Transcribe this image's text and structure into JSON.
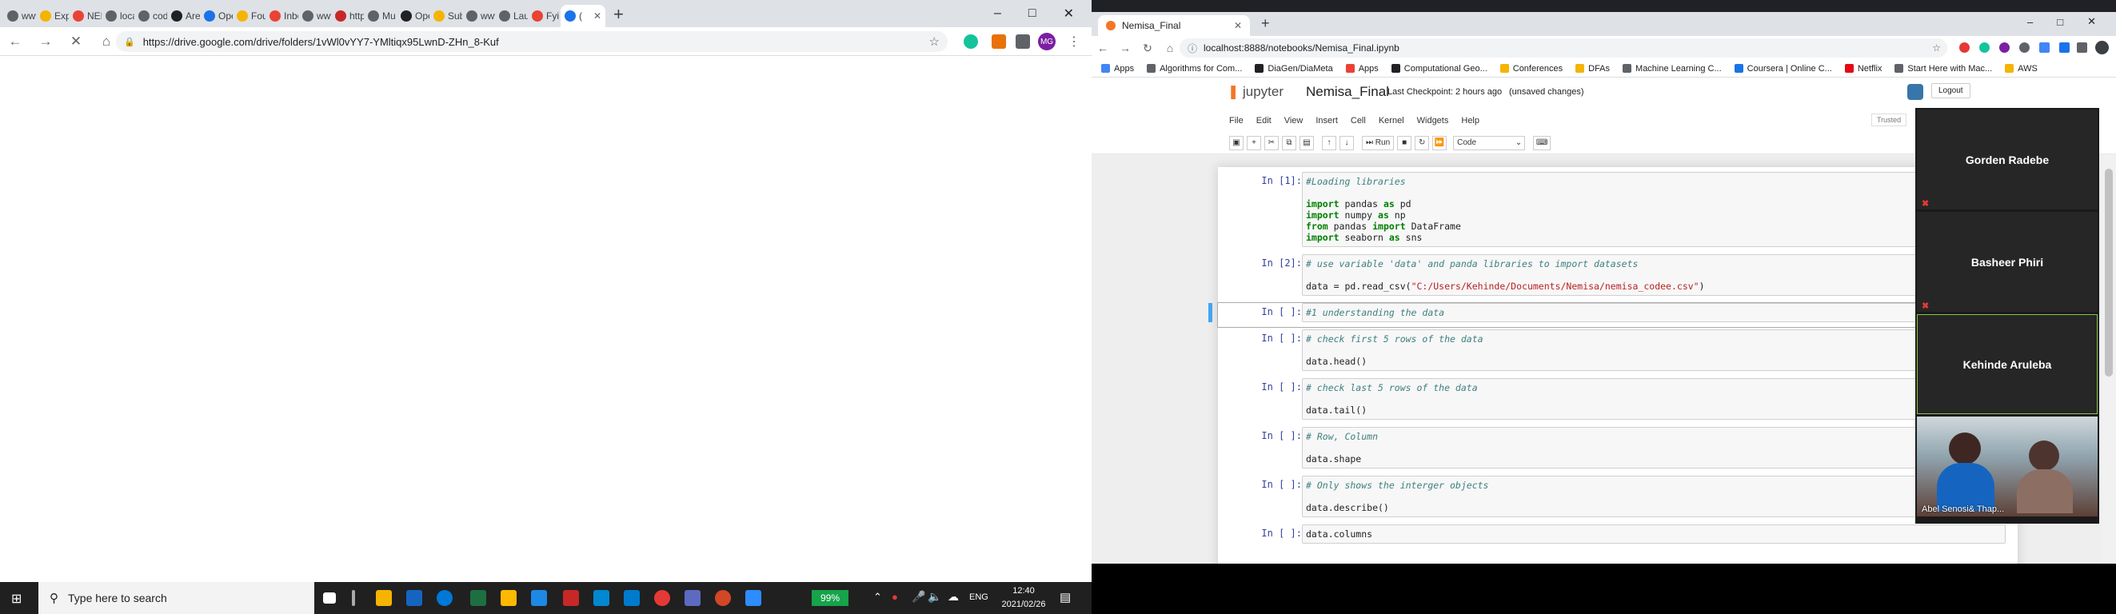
{
  "left_browser": {
    "tabs": [
      {
        "label": "www",
        "color": "#5f6368"
      },
      {
        "label": "Exp",
        "color": "#f4b400"
      },
      {
        "label": "NEN",
        "color": "#ea4335"
      },
      {
        "label": "loca",
        "color": "#5f6368"
      },
      {
        "label": "cod",
        "color": "#5f6368"
      },
      {
        "label": "Are",
        "color": "#202124"
      },
      {
        "label": "Ope",
        "color": "#1a73e8"
      },
      {
        "label": "Fou",
        "color": "#f4b400"
      },
      {
        "label": "Inbc",
        "color": "#ea4335"
      },
      {
        "label": "www",
        "color": "#5f6368"
      },
      {
        "label": "http",
        "color": "#c62828"
      },
      {
        "label": "Mu",
        "color": "#5f6368"
      },
      {
        "label": "Ope",
        "color": "#202124"
      },
      {
        "label": "Sub",
        "color": "#f4b400"
      },
      {
        "label": "www",
        "color": "#5f6368"
      },
      {
        "label": "Lau",
        "color": "#5f6368"
      },
      {
        "label": "Fyi",
        "color": "#ea4335"
      },
      {
        "label": "(",
        "color": "#1a73e8",
        "active": true
      }
    ],
    "url": "https://drive.google.com/drive/folders/1vWl0vYY7-YMltiqx95LwnD-ZHn_8-Kuf",
    "profile_initials": "MG"
  },
  "taskbar": {
    "search_placeholder": "Type here to search",
    "battery": "99%",
    "language": "ENG",
    "time": "12:40",
    "date": "2021/02/26"
  },
  "right_browser": {
    "tab_title": "Nemisa_Final",
    "url": "localhost:8888/notebooks/Nemisa_Final.ipynb",
    "bookmarks": [
      {
        "label": "Apps",
        "color": "#4285f4"
      },
      {
        "label": "Algorithms for Com...",
        "color": "#5f6368"
      },
      {
        "label": "DiaGen/DiaMeta",
        "color": "#202124"
      },
      {
        "label": "Apps",
        "color": "#ea4335"
      },
      {
        "label": "Computational Geo...",
        "color": "#202124"
      },
      {
        "label": "Conferences",
        "color": "#f4b400"
      },
      {
        "label": "DFAs",
        "color": "#f4b400"
      },
      {
        "label": "Machine Learning C...",
        "color": "#5f6368"
      },
      {
        "label": "Coursera | Online C...",
        "color": "#1a73e8"
      },
      {
        "label": "Netflix",
        "color": "#e50914"
      },
      {
        "label": "Start Here with Mac...",
        "color": "#5f6368"
      },
      {
        "label": "AWS",
        "color": "#f4b400"
      }
    ]
  },
  "jupyter": {
    "logo_text": "jupyter",
    "notebook_name": "Nemisa_Final",
    "checkpoint_label": "Last Checkpoint:",
    "checkpoint_time": "2 hours ago",
    "unsaved": "(unsaved changes)",
    "logout_label": "Logout",
    "trusted_label": "Trusted",
    "menu": [
      "File",
      "Edit",
      "View",
      "Insert",
      "Cell",
      "Kernel",
      "Widgets",
      "Help"
    ],
    "run_label": "Run",
    "cell_type": "Code",
    "cells": [
      {
        "prompt": "In [1]:",
        "lines": [
          {
            "parts": [
              {
                "t": "#Loading libraries",
                "c": "cm"
              }
            ]
          },
          {
            "parts": [
              {
                "t": "",
                "c": ""
              }
            ]
          },
          {
            "parts": [
              {
                "t": "import",
                "c": "kw"
              },
              {
                "t": " pandas ",
                "c": ""
              },
              {
                "t": "as",
                "c": "kw"
              },
              {
                "t": " pd",
                "c": ""
              }
            ]
          },
          {
            "parts": [
              {
                "t": "import",
                "c": "kw"
              },
              {
                "t": " numpy ",
                "c": ""
              },
              {
                "t": "as",
                "c": "kw"
              },
              {
                "t": " np",
                "c": ""
              }
            ]
          },
          {
            "parts": [
              {
                "t": "from",
                "c": "kw"
              },
              {
                "t": " pandas ",
                "c": ""
              },
              {
                "t": "import",
                "c": "kw"
              },
              {
                "t": " DataFrame",
                "c": ""
              }
            ]
          },
          {
            "parts": [
              {
                "t": "import",
                "c": "kw"
              },
              {
                "t": " seaborn ",
                "c": ""
              },
              {
                "t": "as",
                "c": "kw"
              },
              {
                "t": " sns",
                "c": ""
              }
            ]
          }
        ]
      },
      {
        "prompt": "In [2]:",
        "lines": [
          {
            "parts": [
              {
                "t": "# use variable 'data' and panda libraries to import datasets",
                "c": "cm"
              }
            ]
          },
          {
            "parts": [
              {
                "t": "",
                "c": ""
              }
            ]
          },
          {
            "parts": [
              {
                "t": "data = pd.read_csv(",
                "c": ""
              },
              {
                "t": "\"C:/Users/Kehinde/Documents/Nemisa/nemisa_codee.csv\"",
                "c": "str"
              },
              {
                "t": ")",
                "c": ""
              }
            ]
          }
        ]
      },
      {
        "prompt": "In [ ]:",
        "selected": true,
        "lines": [
          {
            "parts": [
              {
                "t": "#1 understanding the data",
                "c": "cm"
              }
            ]
          }
        ]
      },
      {
        "prompt": "In [ ]:",
        "lines": [
          {
            "parts": [
              {
                "t": "# check first 5 rows of the data",
                "c": "cm"
              }
            ]
          },
          {
            "parts": [
              {
                "t": "",
                "c": ""
              }
            ]
          },
          {
            "parts": [
              {
                "t": "data.head()",
                "c": ""
              }
            ]
          }
        ]
      },
      {
        "prompt": "In [ ]:",
        "lines": [
          {
            "parts": [
              {
                "t": "# check last 5 rows of the data",
                "c": "cm"
              }
            ]
          },
          {
            "parts": [
              {
                "t": "",
                "c": ""
              }
            ]
          },
          {
            "parts": [
              {
                "t": "data.tail()",
                "c": ""
              }
            ]
          }
        ]
      },
      {
        "prompt": "In [ ]:",
        "lines": [
          {
            "parts": [
              {
                "t": "# Row, Column",
                "c": "cm"
              }
            ]
          },
          {
            "parts": [
              {
                "t": "",
                "c": ""
              }
            ]
          },
          {
            "parts": [
              {
                "t": "data.shape",
                "c": ""
              }
            ]
          }
        ]
      },
      {
        "prompt": "In [ ]:",
        "lines": [
          {
            "parts": [
              {
                "t": "# Only shows the interger objects",
                "c": "cm"
              }
            ]
          },
          {
            "parts": [
              {
                "t": "",
                "c": ""
              }
            ]
          },
          {
            "parts": [
              {
                "t": "data.describe()",
                "c": ""
              }
            ]
          }
        ]
      },
      {
        "prompt": "In [ ]:",
        "lines": [
          {
            "parts": [
              {
                "t": "data.columns",
                "c": ""
              }
            ]
          }
        ]
      }
    ]
  },
  "meeting": {
    "participants": [
      "Gorden Radebe",
      "Basheer Phiri",
      "Kehinde Aruleba"
    ],
    "video_caption": "Abel  Senosi& Thap..."
  }
}
